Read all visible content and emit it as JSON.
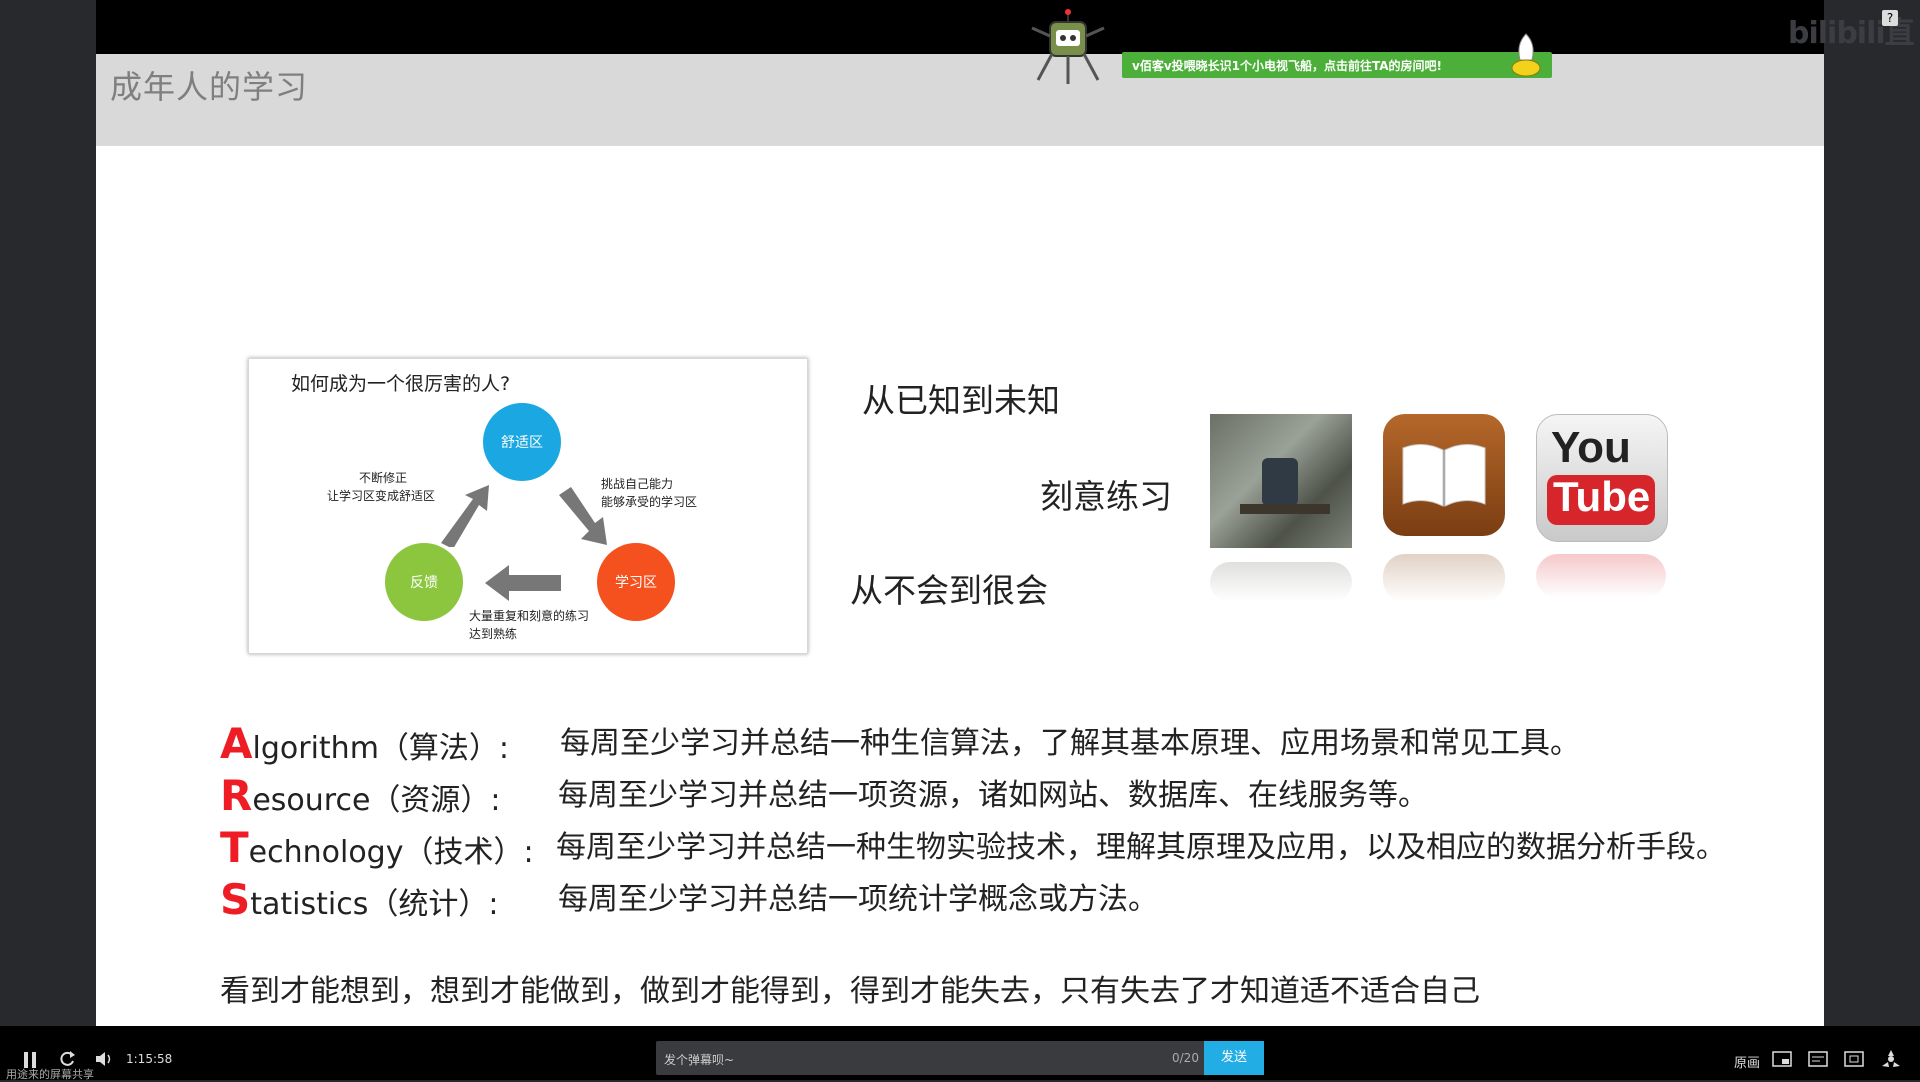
{
  "stream": {
    "watermark": "bilibili直播",
    "help_label": "?",
    "gift_banner": "v佰客v投喂晓长识1个小电视飞船，点击前往TA的房间吧!",
    "share_caption": "用途来的屏幕共享"
  },
  "slide": {
    "title": "成年人的学习",
    "diagram": {
      "heading": "如何成为一个很厉害的人?",
      "comfort_zone": "舒适区",
      "learning_zone": "学习区",
      "feedback": "反馈",
      "note_left_1": "不断修正",
      "note_left_2": "让学习区变成舒适区",
      "note_right_1": "挑战自己能力",
      "note_right_2": "能够承受的学习区",
      "note_bottom_1": "大量重复和刻意的练习",
      "note_bottom_2": "达到熟练"
    },
    "phrase_known": "从已知到未知",
    "phrase_practice": "刻意练习",
    "phrase_master": "从不会到很会",
    "youtube_top": "You",
    "youtube_bottom": "Tube",
    "art": [
      {
        "letter": "A",
        "rest": "lgorithm（算法）:",
        "desc": "每周至少学习并总结一种生信算法，了解其基本原理、应用场景和常见工具。"
      },
      {
        "letter": "R",
        "rest": "esource（资源）:",
        "desc": "每周至少学习并总结一项资源，诸如网站、数据库、在线服务等。"
      },
      {
        "letter": "T",
        "rest": "echnology（技术）:",
        "desc": "每周至少学习并总结一种生物实验技术，理解其原理及应用，以及相应的数据分析手段。"
      },
      {
        "letter": "S",
        "rest": "tatistics（统计）:",
        "desc": "每周至少学习并总结一项统计学概念或方法。"
      }
    ],
    "footer_quote": "看到才能想到，想到才能做到，做到才能得到，得到才能失去，只有失去了才知道适不适合自己"
  },
  "player": {
    "time": "1:15:58",
    "danmaku_placeholder": "发个弹幕呗~",
    "danmaku_count": "0/20",
    "send_label": "发送",
    "quality_label": "原画"
  },
  "colors": {
    "comfort": "#1aa7e2",
    "learning": "#f4511e",
    "feedback": "#8cc63f",
    "art_letter": "#ee1c25",
    "accent_green": "#16c65a",
    "send_button": "#23ade5"
  }
}
